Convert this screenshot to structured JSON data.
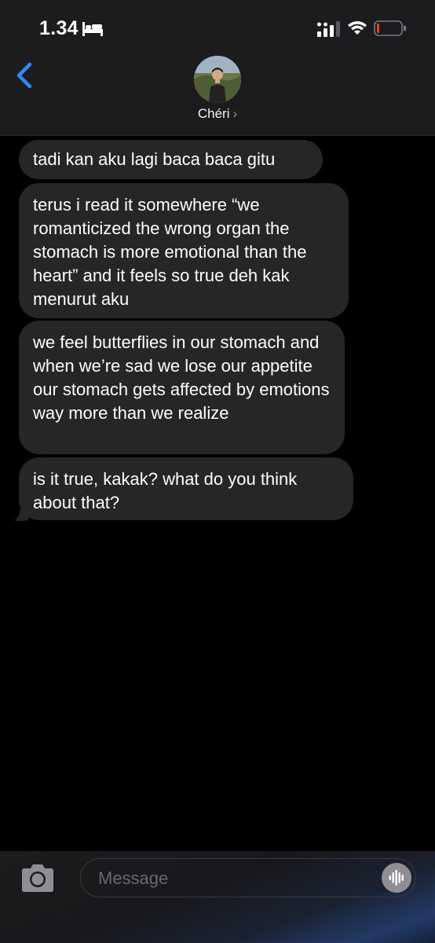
{
  "status_bar": {
    "time": "1.34",
    "bed_icon": "bed-icon",
    "signal_icon": "cellular-signal-icon",
    "wifi_icon": "wifi-icon",
    "battery_icon": "battery-low-icon",
    "battery_level": 0.08,
    "battery_color": "#ff3b30"
  },
  "header": {
    "back_icon": "chevron-left-icon",
    "contact_name": "Chéri",
    "chevron": "›",
    "accent_color": "#2f8bff"
  },
  "messages": [
    {
      "text": "tadi kan aku lagi baca baca gitu"
    },
    {
      "text": "terus i read it somewhere “we romanticized the wrong organ the stomach is more emotional than the heart” and it feels so true deh kak menurut aku"
    },
    {
      "text": "we feel butterflies in our stomach and when we’re sad we lose our appetite our stomach gets affected by emotions way more than we realize"
    },
    {
      "text": "is it true, kakak? what do you think about that?"
    }
  ],
  "input_bar": {
    "camera_icon": "camera-icon",
    "placeholder": "Message",
    "voice_icon": "voice-waveform-icon"
  }
}
